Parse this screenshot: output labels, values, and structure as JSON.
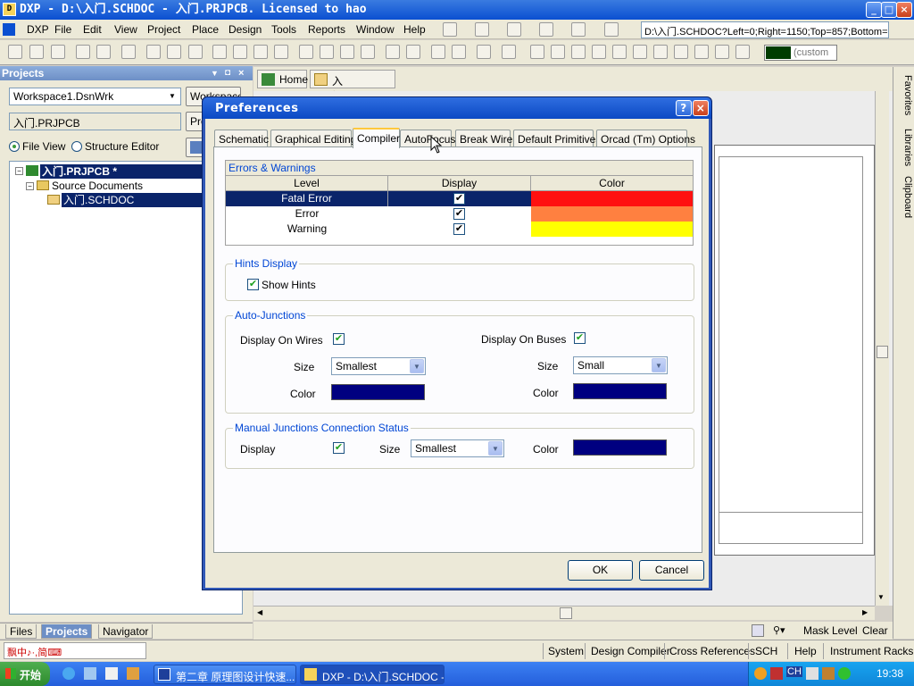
{
  "window": {
    "title": "DXP - D:\\入门.SCHDOC - 入门.PRJPCB. Licensed to hao",
    "app_badge": "DXP"
  },
  "menubar": {
    "items": [
      "DXP",
      "File",
      "Edit",
      "View",
      "Project",
      "Place",
      "Design",
      "Tools",
      "Reports",
      "Window",
      "Help"
    ]
  },
  "path_box": "D:\\入门.SCHDOC?Left=0;Right=1150;Top=857;Bottom=0",
  "custom_color": {
    "label": "(custom",
    "color": "#003c00"
  },
  "right_tabs": [
    "Favorites",
    "Libraries",
    "Clipboard"
  ],
  "projects_panel": {
    "title": "Projects",
    "workspace": "Workspace1.DsnWrk",
    "workspace_button": "Workspace",
    "project": "入门.PRJPCB",
    "project_button": "Project",
    "file_view": "File View",
    "structure_editor": "Structure Editor",
    "tree": {
      "project": "入门.PRJPCB *",
      "folder": "Source Documents",
      "file": "入门.SCHDOC"
    }
  },
  "panel_tabs": [
    "Files",
    "Projects",
    "Navigator"
  ],
  "doc_tabs": {
    "home": "Home",
    "file": "入门.SCHDOC"
  },
  "status": {
    "mask_level": "Mask Level",
    "clear": "Clear",
    "system": "System",
    "design_compiler": "Design Compiler",
    "cross_references": "Cross References",
    "sch": "SCH",
    "help": "Help",
    "instrument_racks": "Instrument Racks"
  },
  "taskbar": {
    "start": "开始",
    "task1": "第二章 原理图设计快速...",
    "task2": "DXP - D:\\入门.SCHDOC - ...",
    "clock": "19:38",
    "ime": "CH"
  },
  "dialog": {
    "title": "Preferences",
    "help_btn": "?",
    "close_btn": "×",
    "tabs": [
      "Schematic",
      "Graphical Editing",
      "Compiler",
      "AutoFocus",
      "Break Wire",
      "Default Primitives",
      "Orcad (Tm) Options"
    ],
    "active_tab": "Compiler",
    "errors": {
      "caption": "Errors & Warnings",
      "columns": [
        "Level",
        "Display",
        "Color"
      ],
      "rows": [
        {
          "level": "Fatal Error",
          "checked": "✔",
          "color": "#ff1010"
        },
        {
          "level": "Error",
          "checked": "✔",
          "color": "#ff8040"
        },
        {
          "level": "Warning",
          "checked": "✔",
          "color": "#ffff00"
        }
      ]
    },
    "hints": {
      "title": "Hints Display",
      "show_hints": "Show Hints"
    },
    "auto_junctions": {
      "title": "Auto-Junctions",
      "wires_label": "Display On Wires",
      "buses_label": "Display On Buses",
      "size_label": "Size",
      "color_label": "Color",
      "wires_size": "Smallest",
      "buses_size": "Small",
      "color": "#000080"
    },
    "manual": {
      "title": "Manual Junctions Connection Status",
      "display_label": "Display",
      "size_label": "Size",
      "size": "Smallest",
      "color_label": "Color",
      "color": "#000080"
    },
    "ok": "OK",
    "cancel": "Cancel"
  }
}
